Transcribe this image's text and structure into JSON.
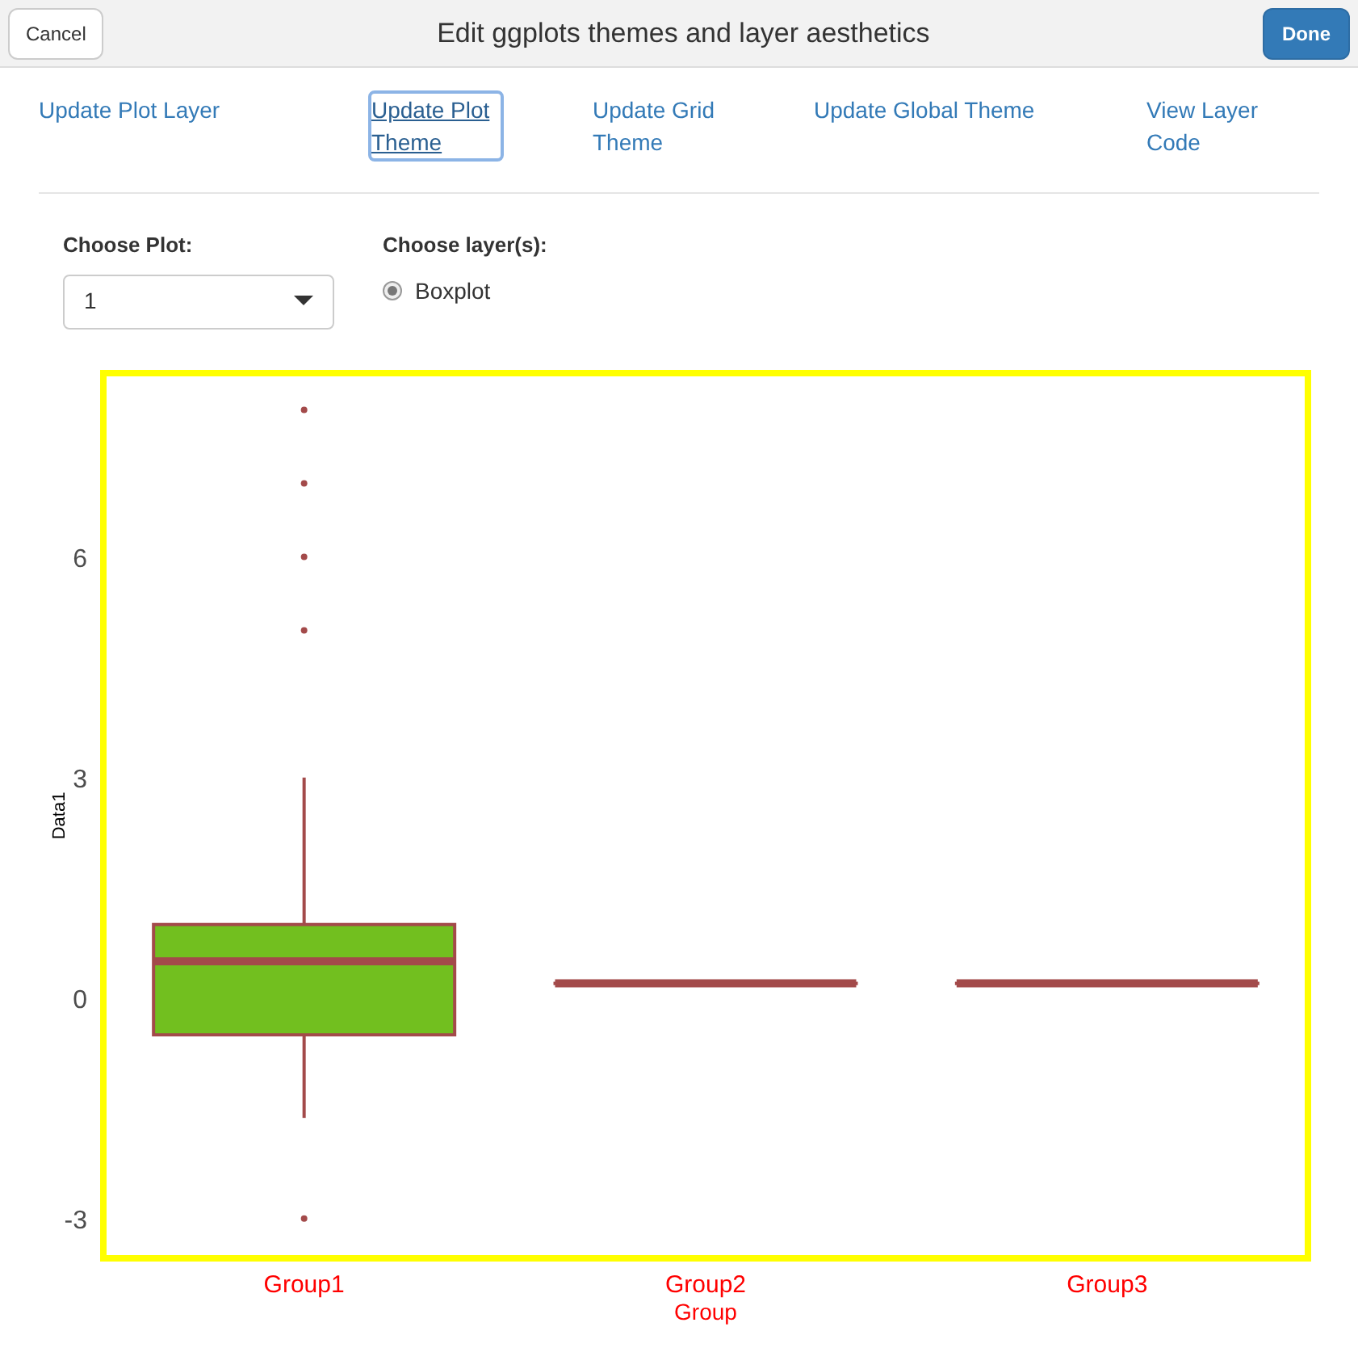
{
  "header": {
    "cancel": "Cancel",
    "title": "Edit ggplots themes and layer aesthetics",
    "done": "Done"
  },
  "tabs": [
    {
      "label": "Update Plot Layer",
      "selected": false
    },
    {
      "label": "Update Plot Theme",
      "selected": true
    },
    {
      "label": "Update Grid Theme",
      "selected": false
    },
    {
      "label": "Update Global Theme",
      "selected": false
    },
    {
      "label": "View Layer Code",
      "selected": false
    }
  ],
  "plot_select": {
    "label": "Choose Plot:",
    "value": "1"
  },
  "layers": {
    "label": "Choose layer(s):",
    "options": [
      {
        "label": "Boxplot",
        "selected": true
      }
    ]
  },
  "plot": {
    "chart_data": {
      "type": "box",
      "color": "#72bf1f",
      "xlabel": "Group",
      "ylabel": "Data1",
      "categories": [
        "Group1",
        "Group2",
        "Group3"
      ],
      "ylim": [
        -3.54,
        8.5
      ],
      "yticks": [
        {
          "value": -3,
          "label": "-3"
        },
        {
          "value": 0,
          "label": "0"
        },
        {
          "value": 3,
          "label": "3"
        },
        {
          "value": 6,
          "label": "6"
        }
      ],
      "boxes": [
        {
          "low": -1.63,
          "q1": -0.5,
          "median": 0.5,
          "q3": 1.0,
          "high": 3,
          "outliers": [
            8,
            7,
            6,
            5,
            -3
          ]
        },
        {
          "low": 0.2,
          "q1": 0.2,
          "median": 0.2,
          "q3": 0.2,
          "high": 0.2
        },
        {
          "low": 0.2,
          "q1": 0.2,
          "median": 0.2,
          "q3": 0.2,
          "high": 0.2
        }
      ]
    }
  }
}
